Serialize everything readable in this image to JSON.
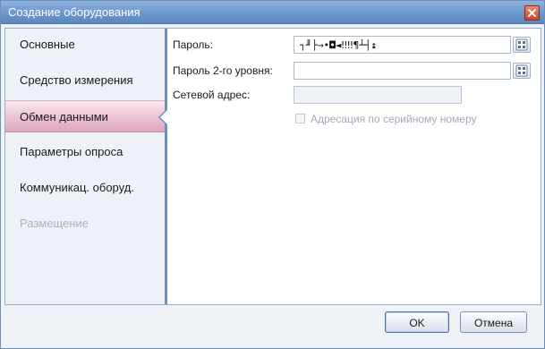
{
  "window": {
    "title": "Создание оборудования",
    "close_icon": "close-icon"
  },
  "sidebar": {
    "items": [
      {
        "label": "Основные",
        "state": "normal"
      },
      {
        "label": "Средство измерения",
        "state": "normal"
      },
      {
        "label": "Обмен данными",
        "state": "selected"
      },
      {
        "label": "Параметры опроса",
        "state": "normal"
      },
      {
        "label": "Коммуникац. оборуд.",
        "state": "normal"
      },
      {
        "label": "Размещение",
        "state": "disabled"
      }
    ]
  },
  "form": {
    "password_label": "Пароль:",
    "password_value": "┐╜├→•◘◄‼‼¶┴┤↨",
    "password2_label": "Пароль 2-го уровня:",
    "password2_value": "",
    "address_label": "Сетевой адрес:",
    "address_value": "",
    "serial_checkbox_label": "Адресация по серийному номеру",
    "serial_checkbox_checked": false,
    "keyboard_icon": "virtual-keyboard-icon"
  },
  "footer": {
    "ok_label": "OK",
    "cancel_label": "Отмена"
  },
  "colors": {
    "titlebar": "#6e97cc",
    "sidebar_accent": "#6f8fbb",
    "selected_item": "#ecc2d3",
    "close_button": "#c9442a"
  }
}
